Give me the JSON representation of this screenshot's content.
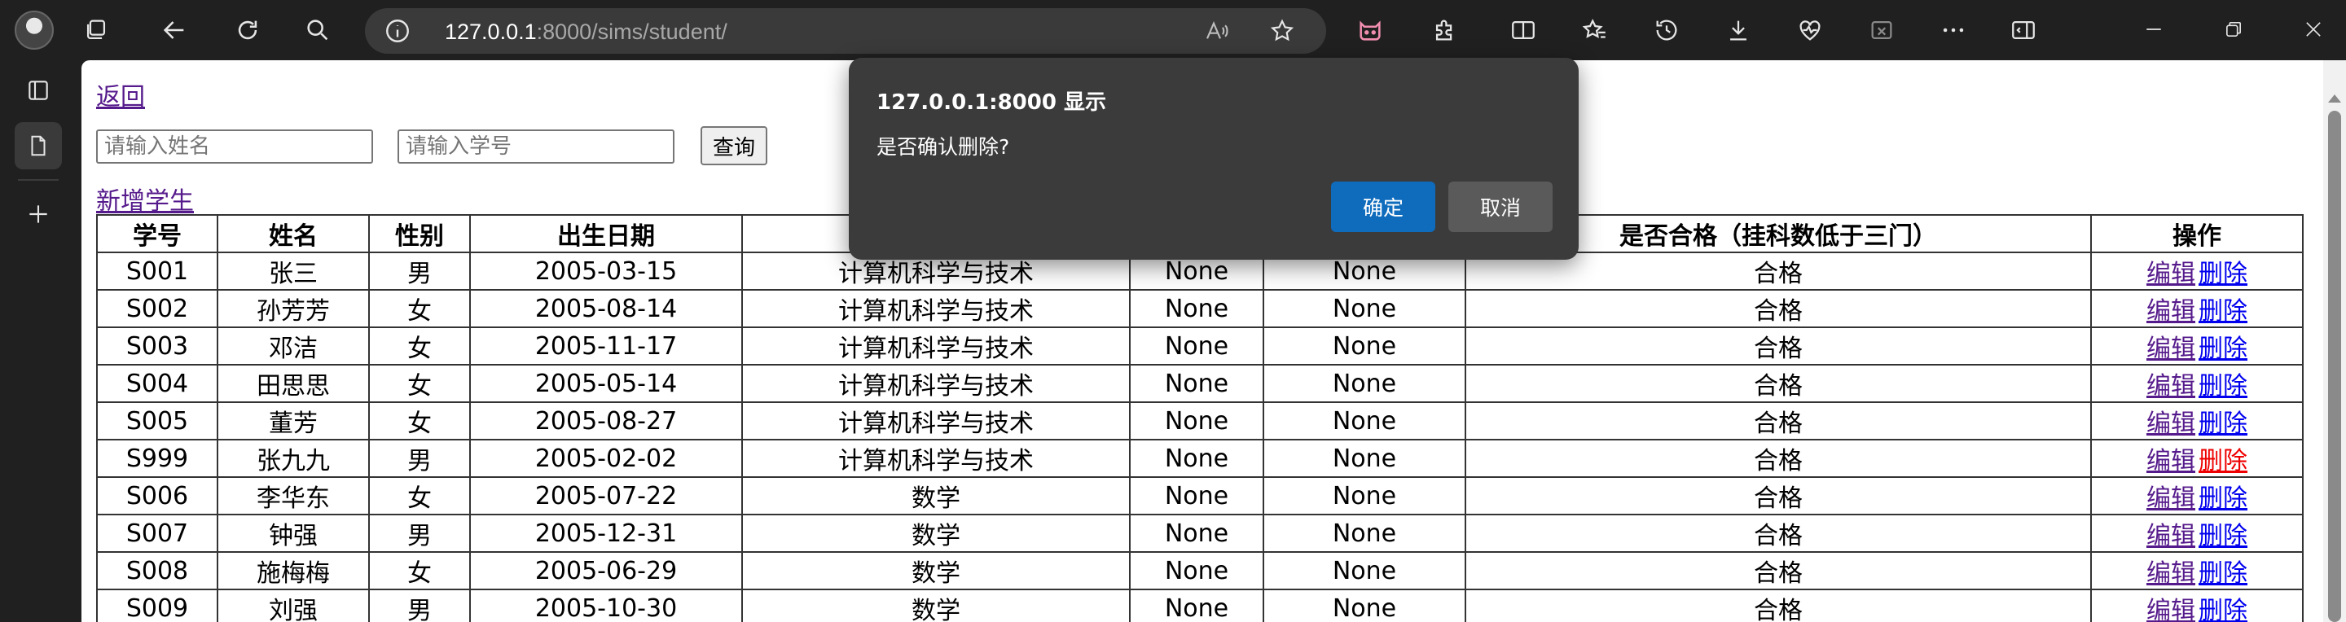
{
  "browser": {
    "url_host": "127.0.0.1",
    "url_rest": ":8000/sims/student/"
  },
  "page": {
    "back_link": "返回",
    "name_placeholder": "请输入姓名",
    "id_placeholder": "请输入学号",
    "query_button": "查询",
    "add_link": "新增学生",
    "headers": [
      "学号",
      "姓名",
      "性别",
      "出生日期",
      "",
      "",
      "",
      "是否合格（挂科数低于三门）",
      "操作"
    ],
    "rows": [
      {
        "id": "S001",
        "name": "张三",
        "gender": "男",
        "birth": "2005-03-15",
        "major": "计算机科学与技术",
        "c1": "None",
        "c2": "None",
        "status": "合格"
      },
      {
        "id": "S002",
        "name": "孙芳芳",
        "gender": "女",
        "birth": "2005-08-14",
        "major": "计算机科学与技术",
        "c1": "None",
        "c2": "None",
        "status": "合格"
      },
      {
        "id": "S003",
        "name": "邓洁",
        "gender": "女",
        "birth": "2005-11-17",
        "major": "计算机科学与技术",
        "c1": "None",
        "c2": "None",
        "status": "合格"
      },
      {
        "id": "S004",
        "name": "田思思",
        "gender": "女",
        "birth": "2005-05-14",
        "major": "计算机科学与技术",
        "c1": "None",
        "c2": "None",
        "status": "合格"
      },
      {
        "id": "S005",
        "name": "董芳",
        "gender": "女",
        "birth": "2005-08-27",
        "major": "计算机科学与技术",
        "c1": "None",
        "c2": "None",
        "status": "合格"
      },
      {
        "id": "S999",
        "name": "张九九",
        "gender": "男",
        "birth": "2005-02-02",
        "major": "计算机科学与技术",
        "c1": "None",
        "c2": "None",
        "status": "合格"
      },
      {
        "id": "S006",
        "name": "李华东",
        "gender": "女",
        "birth": "2005-07-22",
        "major": "数学",
        "c1": "None",
        "c2": "None",
        "status": "合格"
      },
      {
        "id": "S007",
        "name": "钟强",
        "gender": "男",
        "birth": "2005-12-31",
        "major": "数学",
        "c1": "None",
        "c2": "None",
        "status": "合格"
      },
      {
        "id": "S008",
        "name": "施梅梅",
        "gender": "女",
        "birth": "2005-06-29",
        "major": "数学",
        "c1": "None",
        "c2": "None",
        "status": "合格"
      },
      {
        "id": "S009",
        "name": "刘强",
        "gender": "男",
        "birth": "2005-10-30",
        "major": "数学",
        "c1": "None",
        "c2": "None",
        "status": "合格"
      }
    ],
    "edit_label": "编辑",
    "delete_label": "删除"
  },
  "dialog": {
    "title": "127.0.0.1:8000 显示",
    "message": "是否确认删除?",
    "ok": "确定",
    "cancel": "取消"
  },
  "colors": {
    "chrome_bg": "#202020",
    "dialog_bg": "#3b3b3b",
    "primary_button": "#0f6cbd",
    "visited_link": "#551a8b",
    "link": "#0000ee",
    "hover_link": "#ee0000"
  }
}
